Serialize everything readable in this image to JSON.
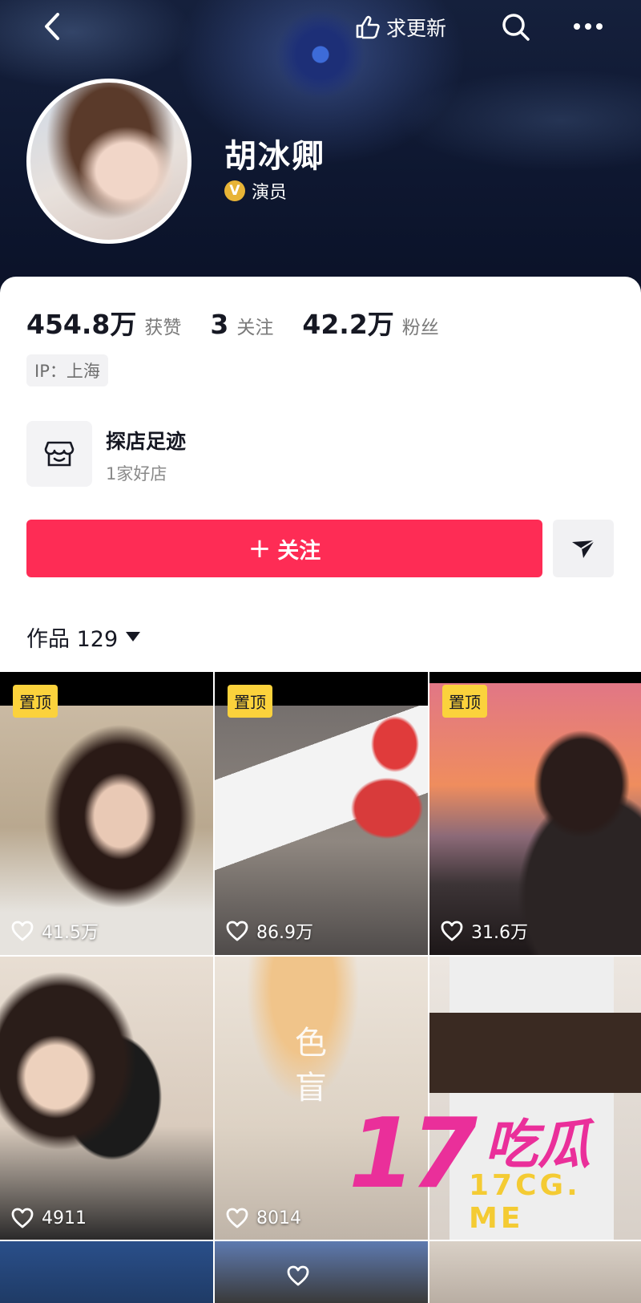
{
  "header": {
    "request_update_label": "求更新",
    "username": "胡冰卿",
    "verified_label": "演员",
    "verified_badge": "V"
  },
  "stats": [
    {
      "value": "454.8万",
      "label": "获赞"
    },
    {
      "value": "3",
      "label": "关注"
    },
    {
      "value": "42.2万",
      "label": "粉丝"
    }
  ],
  "ip_location": "IP：上海",
  "shop": {
    "title": "探店足迹",
    "subtitle": "1家好店"
  },
  "follow_button": {
    "label": "关注",
    "icon": "+",
    "color": "#fe2c55"
  },
  "works_tab": {
    "label": "作品 129"
  },
  "videos": [
    {
      "pinned": "置顶",
      "likes": "41.5万"
    },
    {
      "pinned": "置顶",
      "likes": "86.9万"
    },
    {
      "pinned": "置顶",
      "likes": "31.6万"
    },
    {
      "pinned": "",
      "likes": "4911"
    },
    {
      "pinned": "",
      "likes": "8014"
    },
    {
      "pinned": "",
      "likes": ""
    }
  ],
  "video_text": {
    "thumb5_caption": "色盲"
  },
  "watermark": {
    "number": "17",
    "chinese": "吃瓜",
    "url": "17CG. ME"
  },
  "colors": {
    "pin_badge": "#fbd23c",
    "follow": "#fe2c55",
    "watermark_pink": "#ea2f9a",
    "watermark_yellow": "#f4cb33"
  }
}
